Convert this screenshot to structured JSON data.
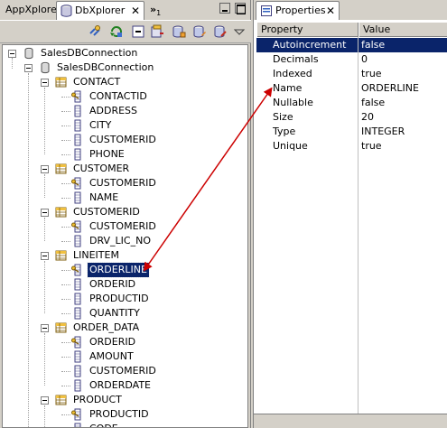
{
  "left_view": {
    "tabs": [
      {
        "label": "AppXplorer"
      },
      {
        "label": "DbXplorer",
        "close": "✕"
      },
      {
        "label": "»",
        "count": "1"
      }
    ]
  },
  "tree": {
    "root": "SalesDBConnection",
    "connection": "SalesDBConnection",
    "tables": [
      {
        "name": "CONTACT",
        "columns": [
          {
            "name": "CONTACTID",
            "key": true
          },
          {
            "name": "ADDRESS"
          },
          {
            "name": "CITY"
          },
          {
            "name": "CUSTOMERID"
          },
          {
            "name": "PHONE"
          }
        ]
      },
      {
        "name": "CUSTOMER",
        "columns": [
          {
            "name": "CUSTOMERID",
            "key": true
          },
          {
            "name": "NAME"
          }
        ]
      },
      {
        "name": "CUSTOMERID",
        "columns": [
          {
            "name": "CUSTOMERID",
            "key": true
          },
          {
            "name": "DRV_LIC_NO"
          }
        ]
      },
      {
        "name": "LINEITEM",
        "columns": [
          {
            "name": "ORDERLINE",
            "key": true,
            "selected": true
          },
          {
            "name": "ORDERID"
          },
          {
            "name": "PRODUCTID"
          },
          {
            "name": "QUANTITY"
          }
        ]
      },
      {
        "name": "ORDER_DATA",
        "columns": [
          {
            "name": "ORDERID",
            "key": true
          },
          {
            "name": "AMOUNT"
          },
          {
            "name": "CUSTOMERID"
          },
          {
            "name": "ORDERDATE"
          }
        ]
      },
      {
        "name": "PRODUCT",
        "columns": [
          {
            "name": "PRODUCTID",
            "key": true
          },
          {
            "name": "CODE"
          }
        ]
      }
    ]
  },
  "properties": {
    "tab_label": "Properties",
    "tab_close": "✕",
    "header": {
      "property": "Property",
      "value": "Value"
    },
    "rows": [
      {
        "key": "Autoincrement",
        "value": "false",
        "selected": true
      },
      {
        "key": "Decimals",
        "value": "0"
      },
      {
        "key": "Indexed",
        "value": "true"
      },
      {
        "key": "Name",
        "value": "ORDERLINE"
      },
      {
        "key": "Nullable",
        "value": "false"
      },
      {
        "key": "Size",
        "value": "20"
      },
      {
        "key": "Type",
        "value": "INTEGER"
      },
      {
        "key": "Unique",
        "value": "true"
      }
    ]
  },
  "colors": {
    "selection": "#0a246a",
    "annotation_arrow": "#cc0000",
    "chrome": "#d4d0c8"
  },
  "icons": {
    "table": "table-icon",
    "column": "column-icon",
    "key_column": "key-column-icon",
    "database": "database-icon",
    "connection": "connection-icon"
  }
}
